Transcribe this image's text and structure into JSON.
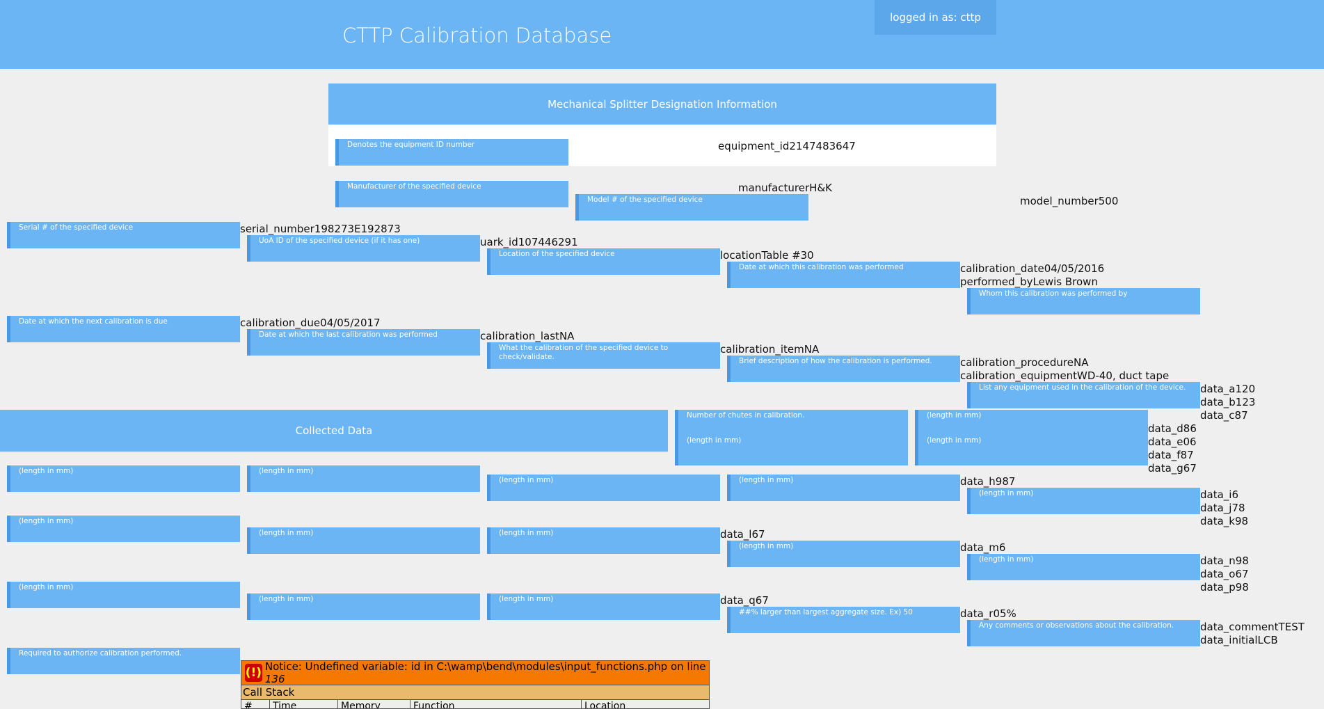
{
  "header": {
    "title": "CTTP Calibration Database",
    "login": "logged in as: cttp"
  },
  "panels": {
    "designation_title": "Mechanical Splitter Designation Information",
    "collected_title": "Collected Data"
  },
  "desc": {
    "equipment_id": "Denotes the equipment ID number",
    "manufacturer": "Manufacturer of the specified device",
    "model": "Model # of the specified device",
    "serial": "Serial # of the specified device",
    "uark": "UoA ID of the specified device (if it has one)",
    "location": "Location of the specified device",
    "cal_date": "Date at which this calibration was performed",
    "performed_by": "Whom this calibration was performed by",
    "cal_due": "Date at which the next calibration is due",
    "cal_last": "Date at which the last calibration was performed",
    "cal_item": "What the calibration of the specified device to check/validate.",
    "cal_procedure": "Brief description of how the calibration is performed.",
    "cal_equipment": "List any equipment used in the calibration of the device.",
    "chutes": "Number of chutes in calibration.",
    "length": "(length in mm)",
    "aggregate": "##% larger than largest aggregate size. Ex) 50",
    "comments": "Any comments or observations about the calibration.",
    "initials": "Required to authorize calibration performed."
  },
  "values": {
    "equipment_id": "equipment_id2147483647",
    "manufacturer": "manufacturerH&K",
    "model_number": "model_number500",
    "serial_number": "serial_number198273E192873",
    "uark_id": "uark_id107446291",
    "location": "locationTable #30",
    "calibration_date": "calibration_date04/05/2016",
    "performed_by": "performed_byLewis Brown",
    "calibration_due": "calibration_due04/05/2017",
    "calibration_last": "calibration_lastNA",
    "calibration_item": "calibration_itemNA",
    "calibration_procedure": "calibration_procedureNA",
    "calibration_equipment": "calibration_equipmentWD-40, duct tape",
    "data_a": "data_a120",
    "data_b": "data_b123",
    "data_c": "data_c87",
    "data_d": "data_d86",
    "data_e": "data_e06",
    "data_f": "data_f87",
    "data_g": "data_g67",
    "data_h": "data_h987",
    "data_i": "data_i6",
    "data_j": "data_j78",
    "data_k": "data_k98",
    "data_l": "data_l67",
    "data_m": "data_m6",
    "data_n": "data_n98",
    "data_o": "data_o67",
    "data_p": "data_p98",
    "data_q": "data_q67",
    "data_r": "data_r05%",
    "data_comment": "data_commentTEST",
    "data_initial": "data_initialLCB"
  },
  "notice": {
    "prefix": "Notice: Undefined variable: id in C:\\wamp\\bend\\modules\\input_functions.php on line ",
    "line": "136",
    "call_stack": "Call Stack",
    "columns": [
      "#",
      "Time",
      "Memory",
      "Function",
      "Location"
    ]
  }
}
